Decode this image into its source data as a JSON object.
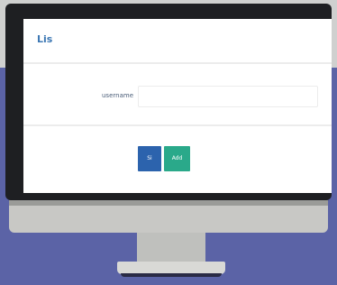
{
  "window": {
    "title": "Lis"
  },
  "form": {
    "field_label": "username",
    "field_value": "",
    "field_placeholder": ""
  },
  "actions": {
    "primary_label": "Si",
    "secondary_label": "Add"
  },
  "colors": {
    "title": "#3d78b4",
    "primary_button": "#2c63ad",
    "secondary_button": "#2aa98a",
    "backdrop": "#5b63a6",
    "bezel": "#1e1f22"
  }
}
